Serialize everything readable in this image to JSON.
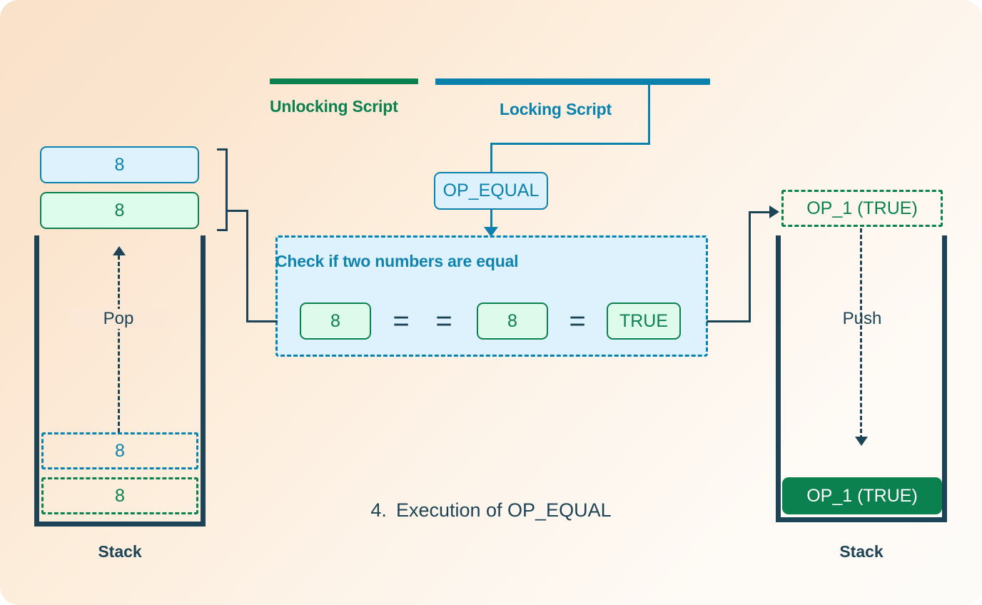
{
  "diagram": {
    "caption_number": "4.",
    "caption_text": "Execution of OP_EQUAL",
    "colors": {
      "unlocking_green": "#0b8150",
      "locking_blue": "#0b82ae",
      "stack_navy": "#1d4456",
      "panel_fill": "#ddf2fc",
      "background_start": "#fae1c9",
      "background_end": "#fdfbf8"
    }
  },
  "scripts": {
    "unlocking": {
      "label": "Unlocking Script"
    },
    "locking": {
      "label": "Locking Script"
    }
  },
  "opcode": {
    "label": "OP_EQUAL"
  },
  "evaluation": {
    "title": "Check if two numbers are equal",
    "operand_left": "8",
    "operator_first": "=",
    "operator_second": "=",
    "operand_right": "8",
    "operator_result": "=",
    "result": "TRUE"
  },
  "left_stack": {
    "caption": "Stack",
    "action_label": "Pop",
    "popped_items": [
      {
        "value": "8",
        "type": "unlocking-blue"
      },
      {
        "value": "8",
        "type": "unlocking-green"
      }
    ],
    "ghost_items": [
      {
        "value": "8",
        "type": "ghost-blue"
      },
      {
        "value": "8",
        "type": "ghost-green"
      }
    ]
  },
  "right_stack": {
    "caption": "Stack",
    "action_label": "Push",
    "ghost_item": {
      "value": "OP_1 (TRUE)"
    },
    "pushed_item": {
      "value": "OP_1 (TRUE)"
    }
  }
}
